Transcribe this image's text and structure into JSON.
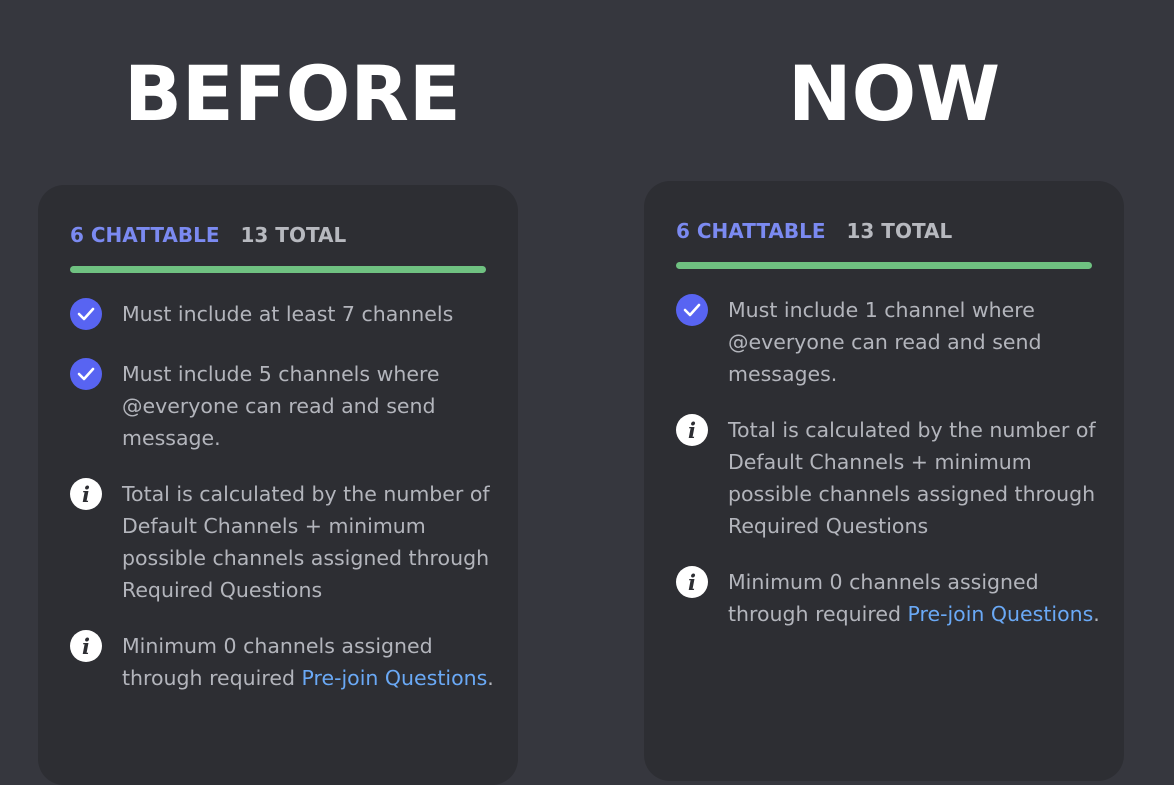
{
  "headings": {
    "before": "BEFORE",
    "now": "NOW"
  },
  "before": {
    "chattable": "6 CHATTABLE",
    "total": "13 TOTAL",
    "items": [
      {
        "icon": "check-icon",
        "text": "Must include at least 7 channels"
      },
      {
        "icon": "check-icon",
        "text": "Must include 5 channels where @everyone can read and send message."
      },
      {
        "icon": "info-icon",
        "text": "Total is calculated by the number of Default Channels + minimum possible channels assigned through Required Questions"
      },
      {
        "icon": "info-icon",
        "text": "Minimum 0 channels assigned through required ",
        "link": "Pre-join Questions",
        "suffix": "."
      }
    ]
  },
  "now": {
    "chattable": "6 CHATTABLE",
    "total": "13 TOTAL",
    "items": [
      {
        "icon": "check-icon",
        "text": "Must include 1 channel where @everyone can read and send messages."
      },
      {
        "icon": "info-icon",
        "text": "Total is calculated by the number of Default Channels + minimum possible channels assigned through Required Questions"
      },
      {
        "icon": "info-icon",
        "text": "Minimum 0 channels assigned through required ",
        "link": "Pre-join Questions",
        "suffix": "."
      }
    ]
  },
  "colors": {
    "background": "#36373e",
    "card": "#2d2e33",
    "chattable": "#7b8af1",
    "progress": "#6fc181",
    "check": "#5864f2",
    "link": "#6aa9f6"
  }
}
